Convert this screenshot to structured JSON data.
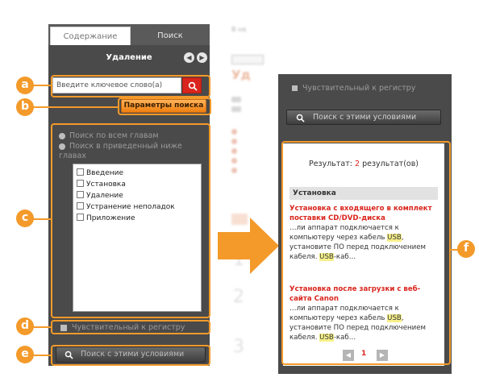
{
  "background_page": {
    "title_text": "В на",
    "heading": "Уд",
    "tab_label": "Уд",
    "numbers": [
      "1",
      "2",
      "3"
    ]
  },
  "nav_panel": {
    "tabs": {
      "contents": "Содержание",
      "search": "Поиск"
    },
    "heading": "Удаление",
    "keyword_input": {
      "placeholder": "Введите ключевое слово(а)",
      "value": ""
    },
    "search_options_label": "Параметры поиска",
    "scope": {
      "all_chapters": "Поиск по всем главам",
      "chapters_below": "Поиск в приведенный ниже главах"
    },
    "chapters": [
      "Введение",
      "Установка",
      "Удаление",
      "Устранение неполадок",
      "Приложение"
    ],
    "case_sensitive": "Чувствительный к регистру",
    "search_with_conditions": "Поиск с этими условиями"
  },
  "results_panel": {
    "case_sensitive": "Чувствительный к регистру",
    "search_with_conditions": "Поиск с этими условиями",
    "result_prefix": "Результат: ",
    "result_count": "2",
    "result_suffix": " результат(ов)",
    "section": "Установка",
    "items": [
      {
        "title": "Установка с входящего в комплект поставки CD/DVD-диска",
        "snip1": "…ли аппарат подключается к компьютеру через кабель ",
        "usb1": "USB",
        "snip2": ", установите ПО перед подключением кабеля. ",
        "usb2": "USB",
        "snip3": "-каб…"
      },
      {
        "title": "Установка после загрузки с веб-сайта Canon",
        "snip1": "…ли аппарат подключается к компьютеру через кабель ",
        "usb1": "USB",
        "snip2": ", установите ПО перед подключением кабеля. ",
        "usb2": "USB",
        "snip3": "-каб…"
      }
    ],
    "current_page": "1"
  },
  "markers": [
    "a",
    "b",
    "c",
    "d",
    "e",
    "f"
  ],
  "colors": {
    "accent": "#f39a2a",
    "red": "#d9251d",
    "panel": "#4a4a4a"
  }
}
